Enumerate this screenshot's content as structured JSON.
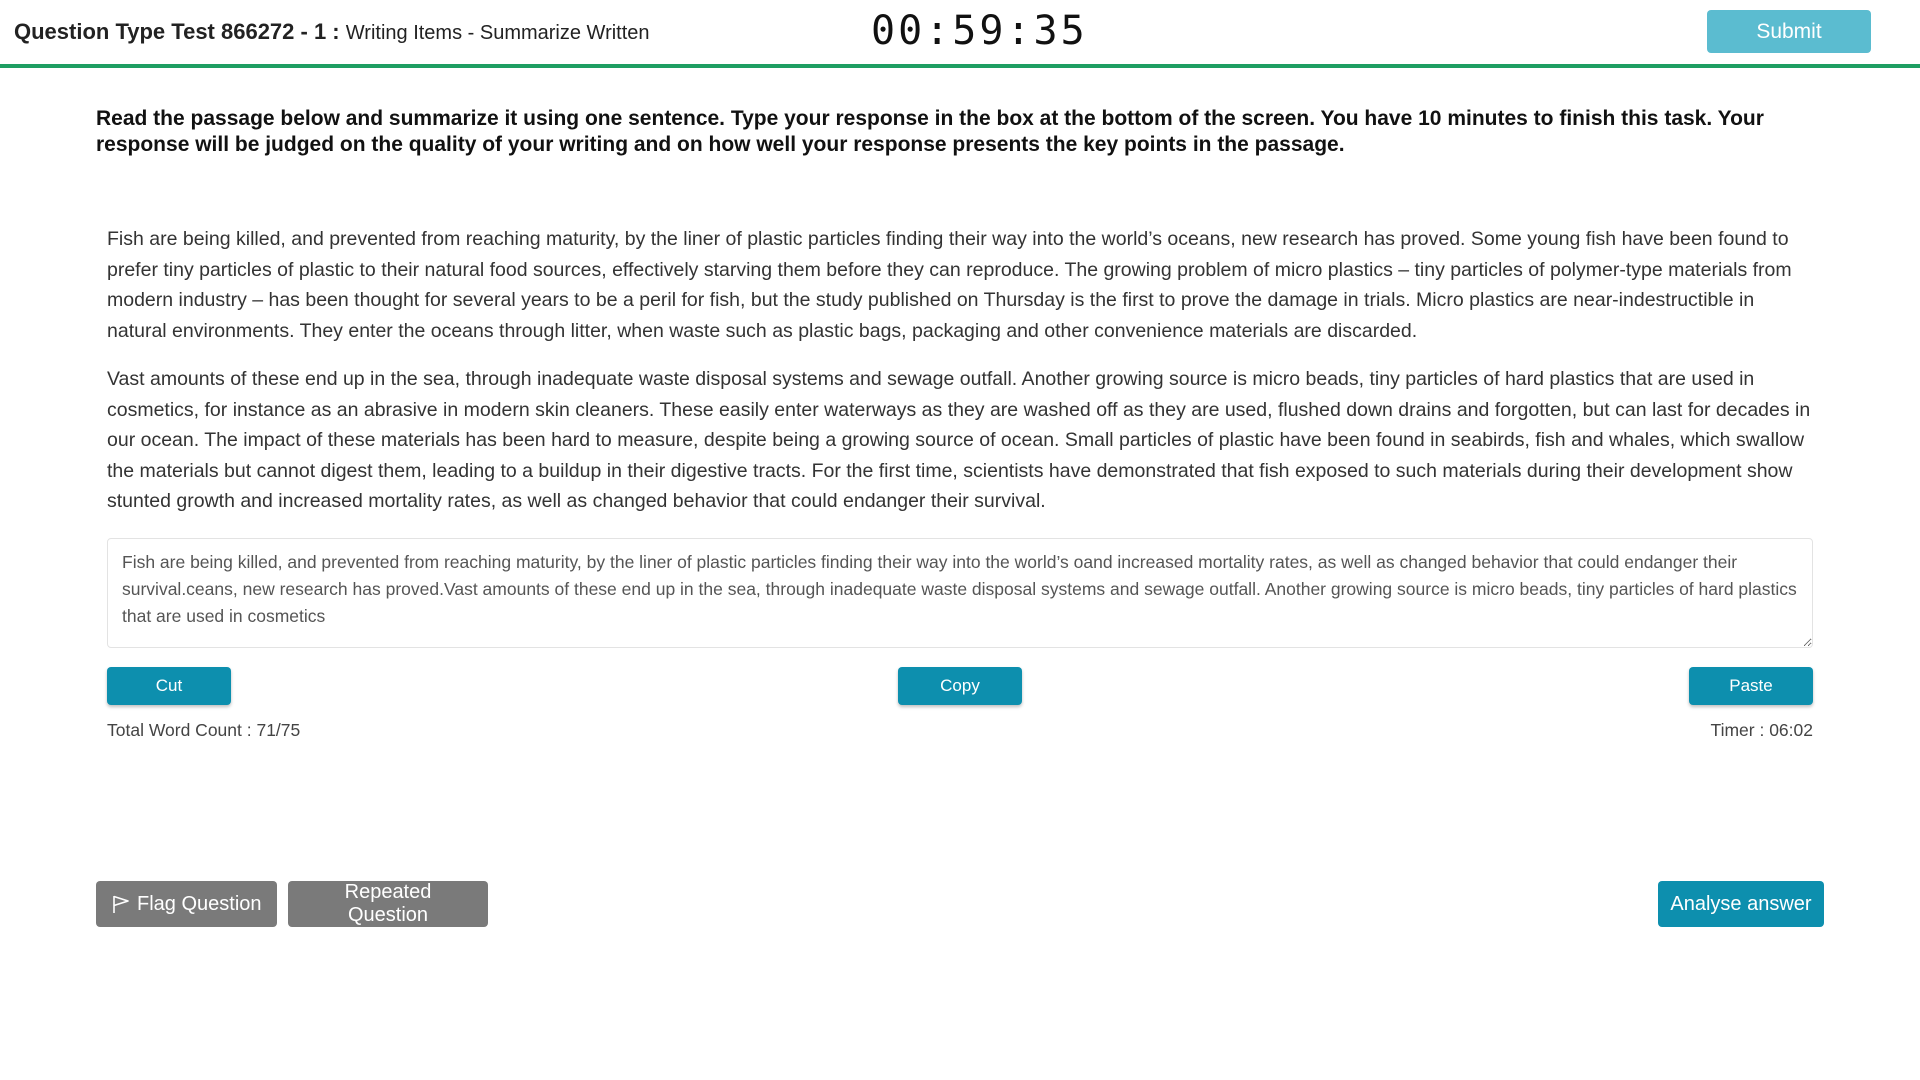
{
  "header": {
    "title_bold": "Question Type Test 866272 - 1 :",
    "title_sub": "Writing Items - Summarize Written",
    "timer": "00:59:35",
    "submit_label": "Submit"
  },
  "instructions": "Read the passage below and summarize it using one sentence. Type your response in the box at the bottom of the screen. You have 10 minutes to finish this task. Your response will be judged on the quality of your writing and on how well your response presents the key points in the passage.",
  "passage": {
    "paragraphs": [
      "Fish are being killed, and prevented from reaching maturity, by the liner of plastic particles finding their way into the world’s oceans, new research has proved. Some young fish have been found to prefer tiny particles of plastic to their natural food sources, effectively starving them before they can reproduce. The growing problem of micro plastics – tiny particles of polymer-type materials from modern industry – has been thought for several years to be a peril for fish, but the study published on Thursday is the first to prove the damage in trials. Micro plastics are near-indestructible in natural environments. They enter the oceans through litter, when waste such as plastic bags, packaging and other convenience materials are discarded.",
      "Vast amounts of these end up in the sea, through inadequate waste disposal systems and sewage outfall. Another growing source is micro beads, tiny particles of hard plastics that are used in cosmetics, for instance as an abrasive in modern skin cleaners. These easily enter waterways as they are washed off as they are used, flushed down drains and forgotten, but can last for decades in our ocean. The impact of these materials has been hard to measure, despite being a growing source of ocean. Small particles of plastic have been found in seabirds, fish and whales, which swallow the materials but cannot digest them, leading to a buildup in their digestive tracts. For the first time, scientists have demonstrated that fish exposed to such materials during their development show stunted growth and increased mortality rates, as well as changed behavior that could endanger their survival."
    ]
  },
  "response": {
    "value": "Fish are being killed, and prevented from reaching maturity, by the liner of plastic particles finding their way into the world’s oand increased mortality rates, as well as changed behavior that could endanger their survival.ceans, new research has proved.Vast amounts of these end up in the sea, through inadequate waste disposal systems and sewage outfall. Another growing source is micro beads, tiny particles of hard plastics that are used in cosmetics"
  },
  "actions": {
    "cut_label": "Cut",
    "copy_label": "Copy",
    "paste_label": "Paste"
  },
  "stats": {
    "word_count": "Total Word Count : 71/75",
    "timer": "Timer : 06:02"
  },
  "footer": {
    "flag_label": "Flag Question",
    "repeated_label": "Repeated Question",
    "analyse_label": "Analyse answer"
  },
  "colors": {
    "accent": "#0d8fae",
    "submit": "#5bbcd0",
    "header_border": "#1e9e62",
    "gray_button": "#7a7a7a"
  },
  "icons": {
    "flag": "flag-icon"
  }
}
